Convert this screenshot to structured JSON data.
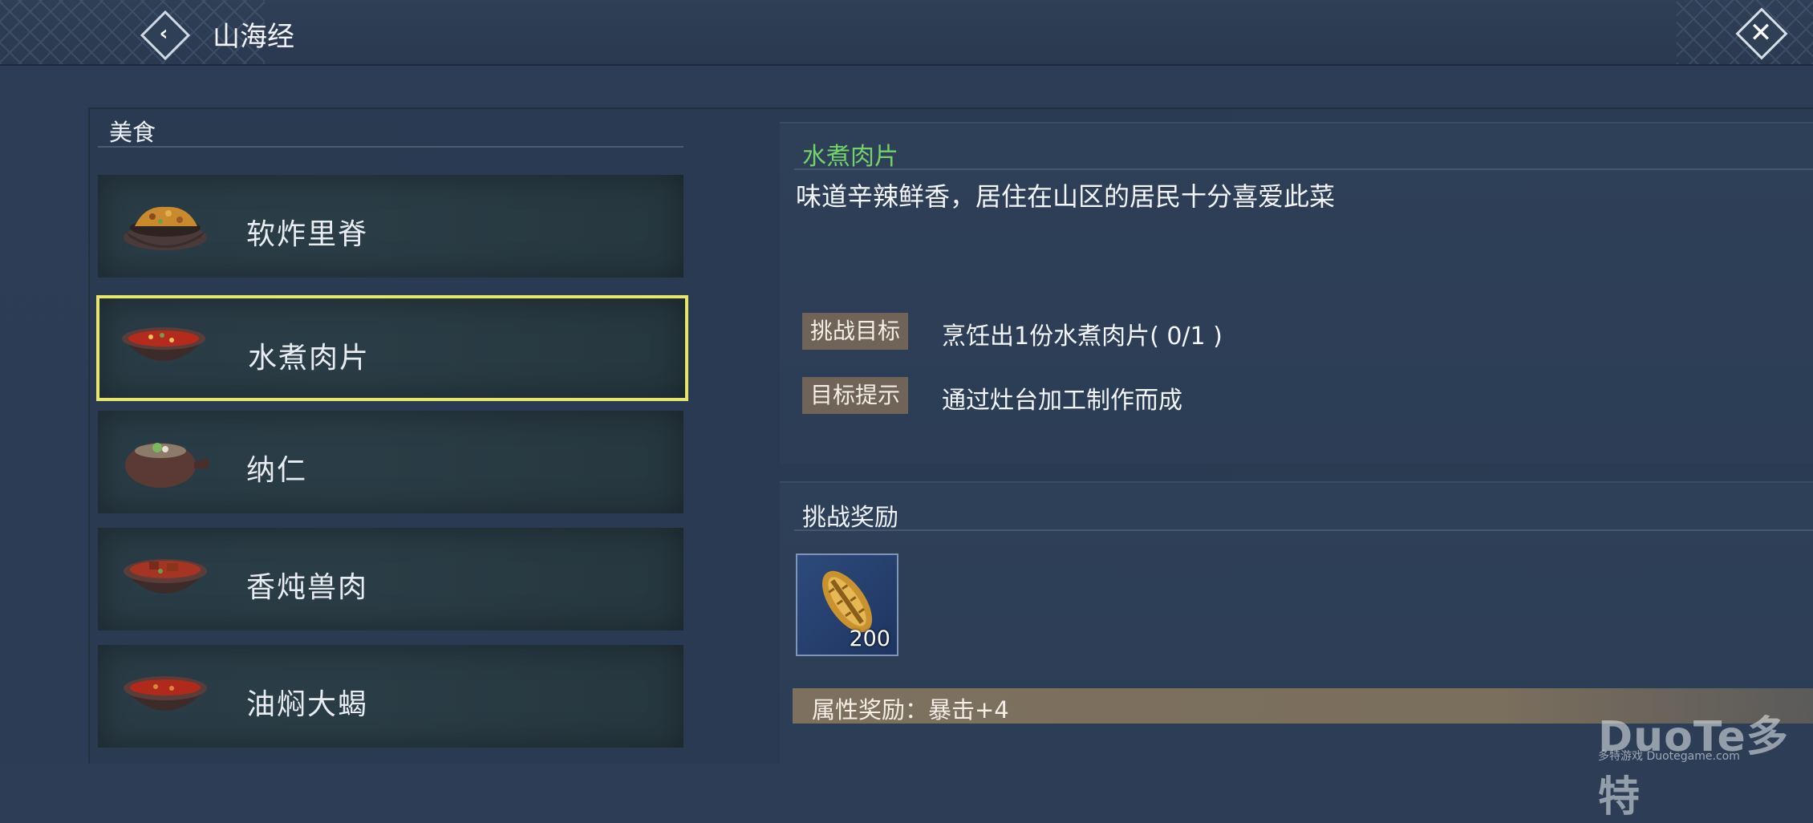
{
  "header": {
    "title": "山海经",
    "back_icon": "chevron-left-icon",
    "close_icon": "close-x-icon"
  },
  "category": {
    "title": "美食"
  },
  "dishes": [
    {
      "name": "软炸里脊",
      "icon": "fried-tenderloin-bowl-icon",
      "selected": false
    },
    {
      "name": "水煮肉片",
      "icon": "boiled-pork-bowl-icon",
      "selected": true
    },
    {
      "name": "纳仁",
      "icon": "naren-pot-icon",
      "selected": false
    },
    {
      "name": "香炖兽肉",
      "icon": "stewed-meat-bowl-icon",
      "selected": false
    },
    {
      "name": "油焖大蝎",
      "icon": "braised-scorpion-bowl-icon",
      "selected": false
    }
  ],
  "detail": {
    "name": "水煮肉片",
    "description": "味道辛辣鲜香，居住在山区的居民十分喜爱此菜",
    "goal_tag": "挑战目标",
    "goal_text": "烹饪出1份水煮肉片( 0/1 )",
    "hint_tag": "目标提示",
    "hint_text": "通过灶台加工制作而成"
  },
  "rewards": {
    "title": "挑战奖励",
    "item_icon": "bronze-coin-shell-icon",
    "item_count": "200",
    "attribute_text": "属性奖励：暴击+4"
  },
  "watermark": {
    "main": "DuoTe多特",
    "sub": "多特游戏 Duotegame.com"
  },
  "colors": {
    "selected_border": "#e7e66b",
    "dish_name_green": "#73d26a",
    "tag_bg": "#6f6457"
  }
}
